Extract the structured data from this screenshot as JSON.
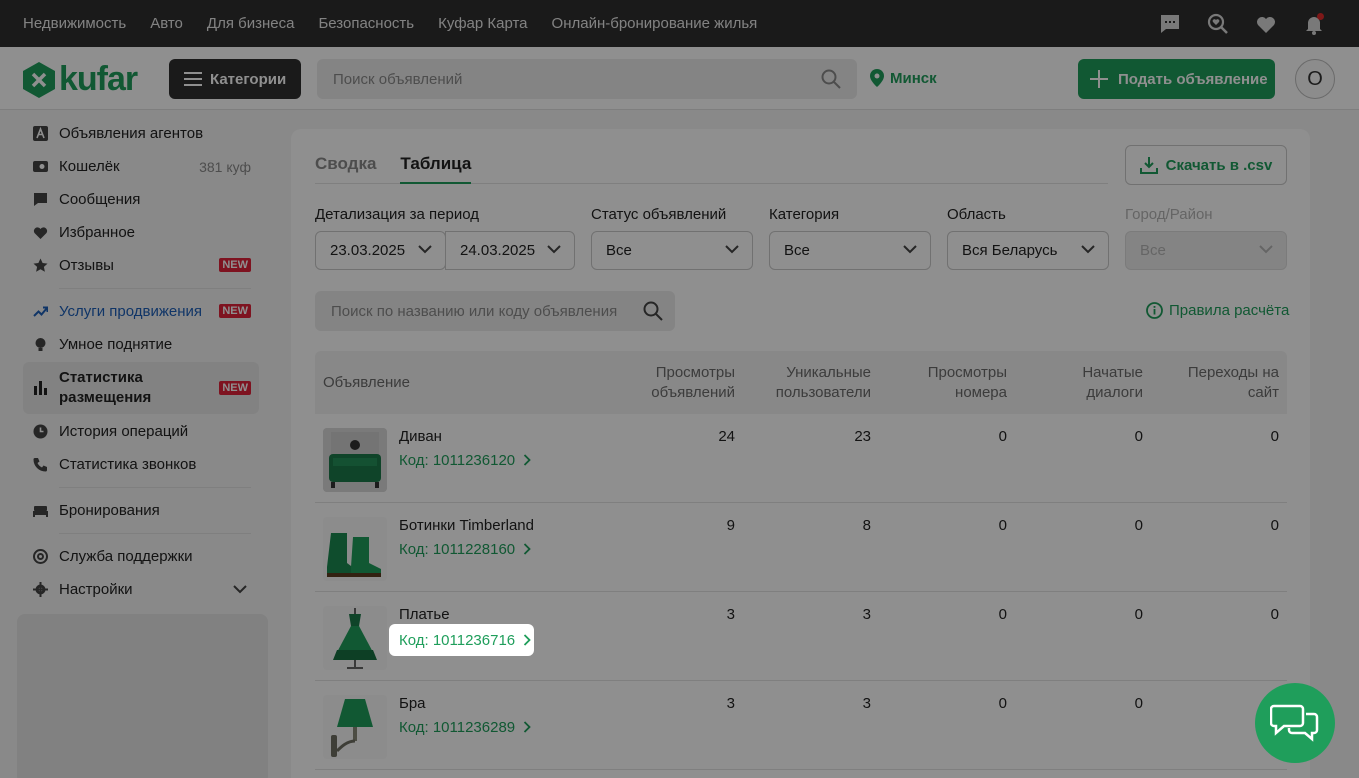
{
  "topbar": {
    "links": [
      "Недвижимость",
      "Авто",
      "Для бизнеса",
      "Безопасность",
      "Куфар Карта",
      "Онлайн-бронирование жилья"
    ],
    "icons": [
      "messages-icon",
      "search-heart-icon",
      "heart-icon",
      "bell-icon"
    ]
  },
  "header": {
    "logo": "kufar",
    "categories_label": "Категории",
    "search_placeholder": "Поиск объявлений",
    "city": "Минск",
    "post_label": "Подать объявление",
    "avatar_letter": "О"
  },
  "sidebar": {
    "items": [
      {
        "label": "Объявления агентов",
        "icon": "agent-icon"
      },
      {
        "label": "Кошелёк",
        "icon": "wallet-icon",
        "right": "381 куф"
      },
      {
        "label": "Сообщения",
        "icon": "chat-icon"
      },
      {
        "label": "Избранное",
        "icon": "heart-icon"
      },
      {
        "label": "Отзывы",
        "icon": "star-icon",
        "badge": "NEW"
      },
      {
        "label": "Услуги продвижения",
        "icon": "trend-icon",
        "badge": "NEW"
      },
      {
        "label": "Умное поднятие",
        "icon": "bulb-icon"
      },
      {
        "label": "Статистика размещения",
        "icon": "bars-icon",
        "badge": "NEW"
      },
      {
        "label": "История операций",
        "icon": "clock-icon"
      },
      {
        "label": "Статистика звонков",
        "icon": "phone-icon"
      },
      {
        "label": "Бронирования",
        "icon": "bed-icon"
      },
      {
        "label": "Служба поддержки",
        "icon": "support-icon"
      },
      {
        "label": "Настройки",
        "icon": "gear-icon"
      }
    ]
  },
  "stats": {
    "tabs": [
      "Сводка",
      "Таблица"
    ],
    "csv_label": "Скачать в .csv",
    "filters": {
      "period_label": "Детализация за период",
      "date_from": "23.03.2025",
      "date_to": "24.03.2025",
      "status_label": "Статус объявлений",
      "status_value": "Все",
      "category_label": "Категория",
      "category_value": "Все",
      "region_label": "Область",
      "region_value": "Вся Беларусь",
      "city_label": "Город/Район",
      "city_value": "Все"
    },
    "search_placeholder": "Поиск по названию или коду объявления",
    "rules_label": "Правила расчёта",
    "columns": [
      "Объявление",
      "Просмотры объявлений",
      "Уникальные пользователи",
      "Просмотры номера",
      "Начатые диалоги",
      "Переходы на сайт"
    ],
    "rows": [
      {
        "title": "Диван",
        "code": "Код: 1011236120",
        "values": [
          "24",
          "23",
          "0",
          "0",
          "0"
        ],
        "thumb": "sofa"
      },
      {
        "title": "Ботинки Timberland",
        "code": "Код: 1011228160",
        "values": [
          "9",
          "8",
          "0",
          "0",
          "0"
        ],
        "thumb": "boots"
      },
      {
        "title": "Платье",
        "code": "Код: 1011236716",
        "values": [
          "3",
          "3",
          "0",
          "0",
          "0"
        ],
        "thumb": "dress"
      },
      {
        "title": "Бра",
        "code": "Код: 1011236289",
        "values": [
          "3",
          "3",
          "0",
          "0",
          ""
        ],
        "thumb": "lamp"
      }
    ]
  },
  "colors": {
    "brand_green": "#1f9e5b",
    "badge_red": "#e0223a",
    "link_blue": "#1e5fb8",
    "topbar": "#2f2f2f"
  }
}
